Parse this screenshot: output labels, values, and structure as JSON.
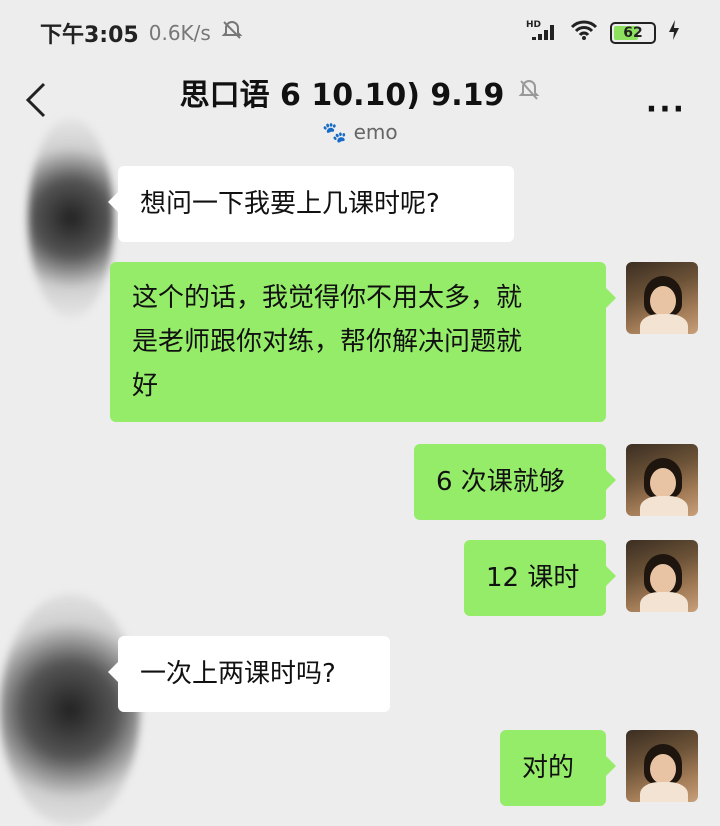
{
  "status_bar": {
    "time": "下午3:05",
    "speed": "0.6K/s",
    "network": "HD",
    "battery": "62",
    "battery_fraction": 0.62
  },
  "header": {
    "title": "思口语 6 10.10) 9.19",
    "subtitle": "emo",
    "icons": [
      "back-icon",
      "muted-bell-icon",
      "more-icon"
    ]
  },
  "messages": [
    {
      "side": "in",
      "text": "想问一下我要上几课时呢?"
    },
    {
      "side": "out",
      "lines": [
        "这个的话，我觉得你不用太多，就",
        "是老师跟你对练，帮你解决问题就",
        "好"
      ]
    },
    {
      "side": "out",
      "text": "6 次课就够"
    },
    {
      "side": "out",
      "text": "12 课时"
    },
    {
      "side": "in",
      "text": "一次上两课时吗?"
    },
    {
      "side": "out",
      "text": "对的"
    }
  ],
  "colors": {
    "background": "#ededed",
    "outgoing_bubble": "#95ec69",
    "incoming_bubble": "#ffffff"
  }
}
